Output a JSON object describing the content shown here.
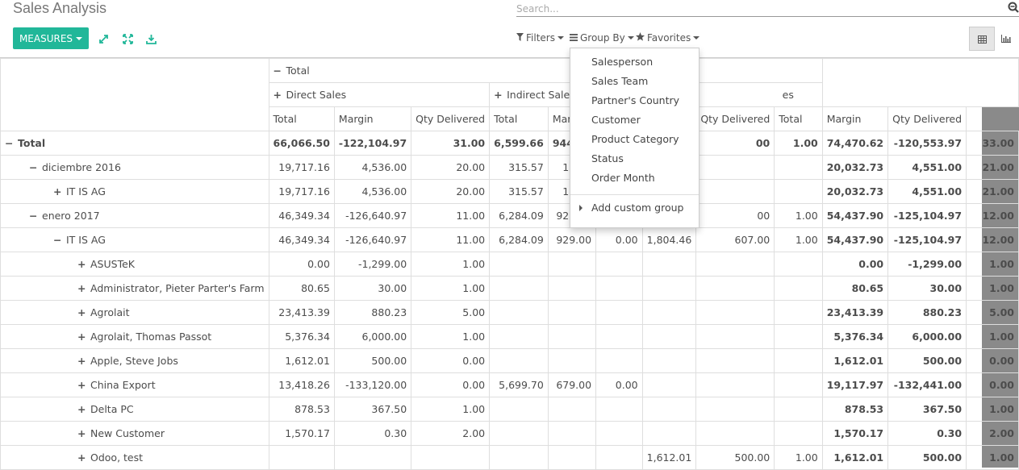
{
  "page": {
    "title": "Sales Analysis"
  },
  "search": {
    "placeholder": "Search..."
  },
  "toolbar": {
    "measures_label": "MEASURES"
  },
  "filters": {
    "filters_label": "Filters",
    "group_by_label": "Group By",
    "favorites_label": "Favorites"
  },
  "colors": {
    "accent": "#21b799",
    "sidebar": "#8a8a8a"
  },
  "icons": [
    "search-icon",
    "expand-icon",
    "fullscreen-icon",
    "download-icon",
    "filter-icon",
    "list-icon",
    "star-icon",
    "table-view-icon",
    "chart-view-icon"
  ],
  "pivot": {
    "col_header_total": "Total",
    "groups": [
      {
        "label": "Direct Sales"
      },
      {
        "label": "Indirect Sales"
      },
      {
        "label": "es"
      }
    ],
    "measure_headers": [
      "Total",
      "Margin",
      "Qty Delivered",
      "Total",
      "Margin",
      "Qty",
      "gin",
      "Qty Delivered",
      "Total",
      "Margin",
      "Qty Delivered"
    ],
    "rows": [
      {
        "label": "Total",
        "exp": "−",
        "cells": [
          "66,066.50",
          "-122,104.97",
          "31.00",
          "6,599.66",
          "944.00",
          "",
          "00",
          "1.00",
          "74,470.62",
          "-120,553.97",
          "33.00"
        ]
      },
      {
        "label": "diciembre 2016",
        "exp": "−",
        "cells": [
          "19,717.16",
          "4,536.00",
          "20.00",
          "315.57",
          "15.00",
          "",
          "",
          "",
          "20,032.73",
          "4,551.00",
          "21.00"
        ]
      },
      {
        "label": "IT IS AG",
        "exp": "+",
        "cells": [
          "19,717.16",
          "4,536.00",
          "20.00",
          "315.57",
          "15.00",
          "",
          "",
          "",
          "20,032.73",
          "4,551.00",
          "21.00"
        ]
      },
      {
        "label": "enero 2017",
        "exp": "−",
        "cells": [
          "46,349.34",
          "-126,640.97",
          "11.00",
          "6,284.09",
          "929.00",
          "",
          "00",
          "1.00",
          "54,437.90",
          "-125,104.97",
          "12.00"
        ]
      },
      {
        "label": "IT IS AG",
        "exp": "−",
        "cells": [
          "46,349.34",
          "-126,640.97",
          "11.00",
          "6,284.09",
          "929.00",
          "0.00",
          "1,804.46",
          "607.00",
          "1.00",
          "54,437.90",
          "-125,104.97",
          "12.00"
        ]
      },
      {
        "label": "ASUSTeK",
        "exp": "+",
        "cells": [
          "0.00",
          "-1,299.00",
          "1.00",
          "",
          "",
          "",
          "",
          "",
          "",
          "0.00",
          "-1,299.00",
          "1.00"
        ]
      },
      {
        "label": "Administrator, Pieter Parter's Farm",
        "exp": "+",
        "cells": [
          "80.65",
          "30.00",
          "1.00",
          "",
          "",
          "",
          "",
          "",
          "",
          "80.65",
          "30.00",
          "1.00"
        ]
      },
      {
        "label": "Agrolait",
        "exp": "+",
        "cells": [
          "23,413.39",
          "880.23",
          "5.00",
          "",
          "",
          "",
          "",
          "",
          "",
          "23,413.39",
          "880.23",
          "5.00"
        ]
      },
      {
        "label": "Agrolait, Thomas Passot",
        "exp": "+",
        "cells": [
          "5,376.34",
          "6,000.00",
          "1.00",
          "",
          "",
          "",
          "",
          "",
          "",
          "5,376.34",
          "6,000.00",
          "1.00"
        ]
      },
      {
        "label": "Apple, Steve Jobs",
        "exp": "+",
        "cells": [
          "1,612.01",
          "500.00",
          "0.00",
          "",
          "",
          "",
          "",
          "",
          "",
          "1,612.01",
          "500.00",
          "0.00"
        ]
      },
      {
        "label": "China Export",
        "exp": "+",
        "cells": [
          "13,418.26",
          "-133,120.00",
          "0.00",
          "5,699.70",
          "679.00",
          "0.00",
          "",
          "",
          "",
          "19,117.97",
          "-132,441.00",
          "0.00"
        ]
      },
      {
        "label": "Delta PC",
        "exp": "+",
        "cells": [
          "878.53",
          "367.50",
          "1.00",
          "",
          "",
          "",
          "",
          "",
          "",
          "878.53",
          "367.50",
          "1.00"
        ]
      },
      {
        "label": "New Customer",
        "exp": "+",
        "cells": [
          "1,570.17",
          "0.30",
          "2.00",
          "",
          "",
          "",
          "",
          "",
          "",
          "1,570.17",
          "0.30",
          "2.00"
        ]
      },
      {
        "label": "Odoo, test",
        "exp": "+",
        "cells": [
          "",
          "",
          "",
          "",
          "",
          "",
          "1,612.01",
          "500.00",
          "1.00",
          "1,612.01",
          "500.00",
          "1.00"
        ]
      }
    ]
  },
  "group_by_menu": {
    "items": [
      "Salesperson",
      "Sales Team",
      "Partner's Country",
      "Customer",
      "Product Category",
      "Status",
      "Order Month"
    ],
    "custom_label": "Add custom group"
  }
}
